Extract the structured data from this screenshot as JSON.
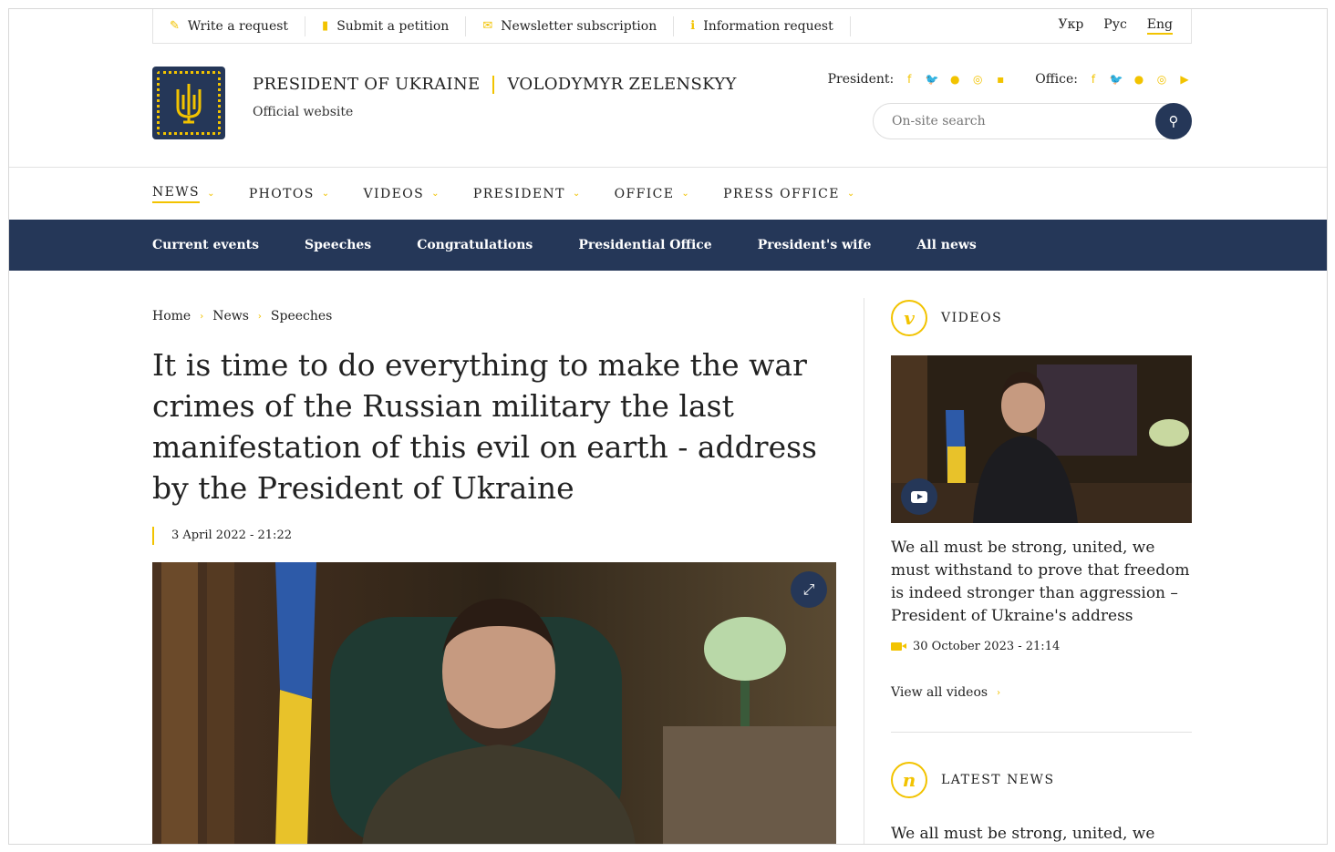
{
  "topbar": {
    "links": [
      {
        "icon": "pencil-icon",
        "label": "Write a request"
      },
      {
        "icon": "document-icon",
        "label": "Submit a petition"
      },
      {
        "icon": "envelope-icon",
        "label": "Newsletter subscription"
      },
      {
        "icon": "info-icon",
        "label": "Information request"
      }
    ],
    "languages": [
      "Укр",
      "Рус",
      "Eng"
    ],
    "active_language": "Eng"
  },
  "header": {
    "title_left": "PRESIDENT OF UKRAINE",
    "title_right": "VOLODYMYR ZELENSKYY",
    "subtitle": "Official website",
    "president_label": "President:",
    "office_label": "Office:",
    "search_placeholder": "On-site search"
  },
  "main_nav": [
    "NEWS",
    "PHOTOS",
    "VIDEOS",
    "PRESIDENT",
    "OFFICE",
    "PRESS OFFICE"
  ],
  "sub_nav": [
    "Current events",
    "Speeches",
    "Congratulations",
    "Presidential Office",
    "President's wife",
    "All news"
  ],
  "breadcrumb": [
    "Home",
    "News",
    "Speeches"
  ],
  "article": {
    "headline": "It is time to do everything to make the war crimes of the Russian military the last manifestation of this evil on earth - address by the President of Ukraine",
    "date": "3 April 2022 - 21:22"
  },
  "sidebar": {
    "videos_heading": "VIDEOS",
    "videos_letter": "v",
    "video_title": "We all must be strong, united, we must withstand to prove that freedom is indeed stronger than aggression – President of Ukraine's address",
    "video_date": "30 October 2023 - 21:14",
    "view_all": "View all videos",
    "news_heading": "LATEST NEWS",
    "news_letter": "n",
    "news_title": "We all must be strong, united, we must"
  },
  "colors": {
    "accent": "#f2c300",
    "navy": "#253758"
  }
}
